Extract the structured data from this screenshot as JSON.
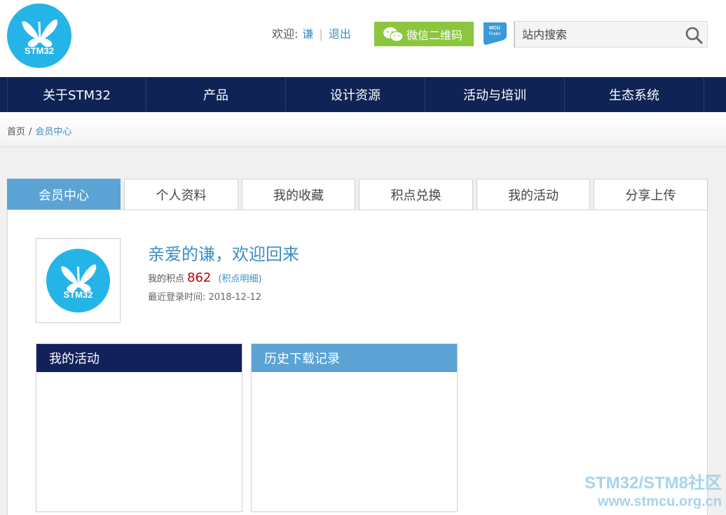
{
  "header": {
    "logo_text": "STM32",
    "welcome_label": "欢迎:",
    "username": "谦",
    "separator": "|",
    "logout_label": "退出",
    "wechat_label": "微信二维码",
    "mcu_badge_line1": "MCU",
    "mcu_badge_line2": "Finder",
    "search_placeholder": "站内搜索"
  },
  "nav": {
    "items": [
      {
        "label": "关于STM32"
      },
      {
        "label": "产品"
      },
      {
        "label": "设计资源"
      },
      {
        "label": "活动与培训"
      },
      {
        "label": "生态系统"
      }
    ]
  },
  "breadcrumb": {
    "home": "首页",
    "slash": "/",
    "current": "会员中心"
  },
  "tabs": [
    {
      "label": "会员中心",
      "active": true
    },
    {
      "label": "个人资料"
    },
    {
      "label": "我的收藏"
    },
    {
      "label": "积点兑换"
    },
    {
      "label": "我的活动"
    },
    {
      "label": "分享上传"
    }
  ],
  "profile": {
    "avatar_text": "STM32",
    "greeting": "亲爱的谦，欢迎回来",
    "points_label": "我的积点",
    "points_value": "862",
    "points_link_open": "(",
    "points_link": "积点明细",
    "points_link_close": ")",
    "last_login_label": "最近登录时间:",
    "last_login_value": "2018-12-12"
  },
  "boxes": {
    "activity_title": "我的活动",
    "history_title": "历史下载记录"
  },
  "watermark": {
    "line1": "STM32/STM8社区",
    "line2": "www.stmcu.org.cn"
  },
  "colors": {
    "nav_bg": "#0f2354",
    "accent_blue": "#5ba3d4",
    "logo_blue": "#25b4e8",
    "wechat_green": "#8cc63f",
    "points_red": "#c00000"
  }
}
